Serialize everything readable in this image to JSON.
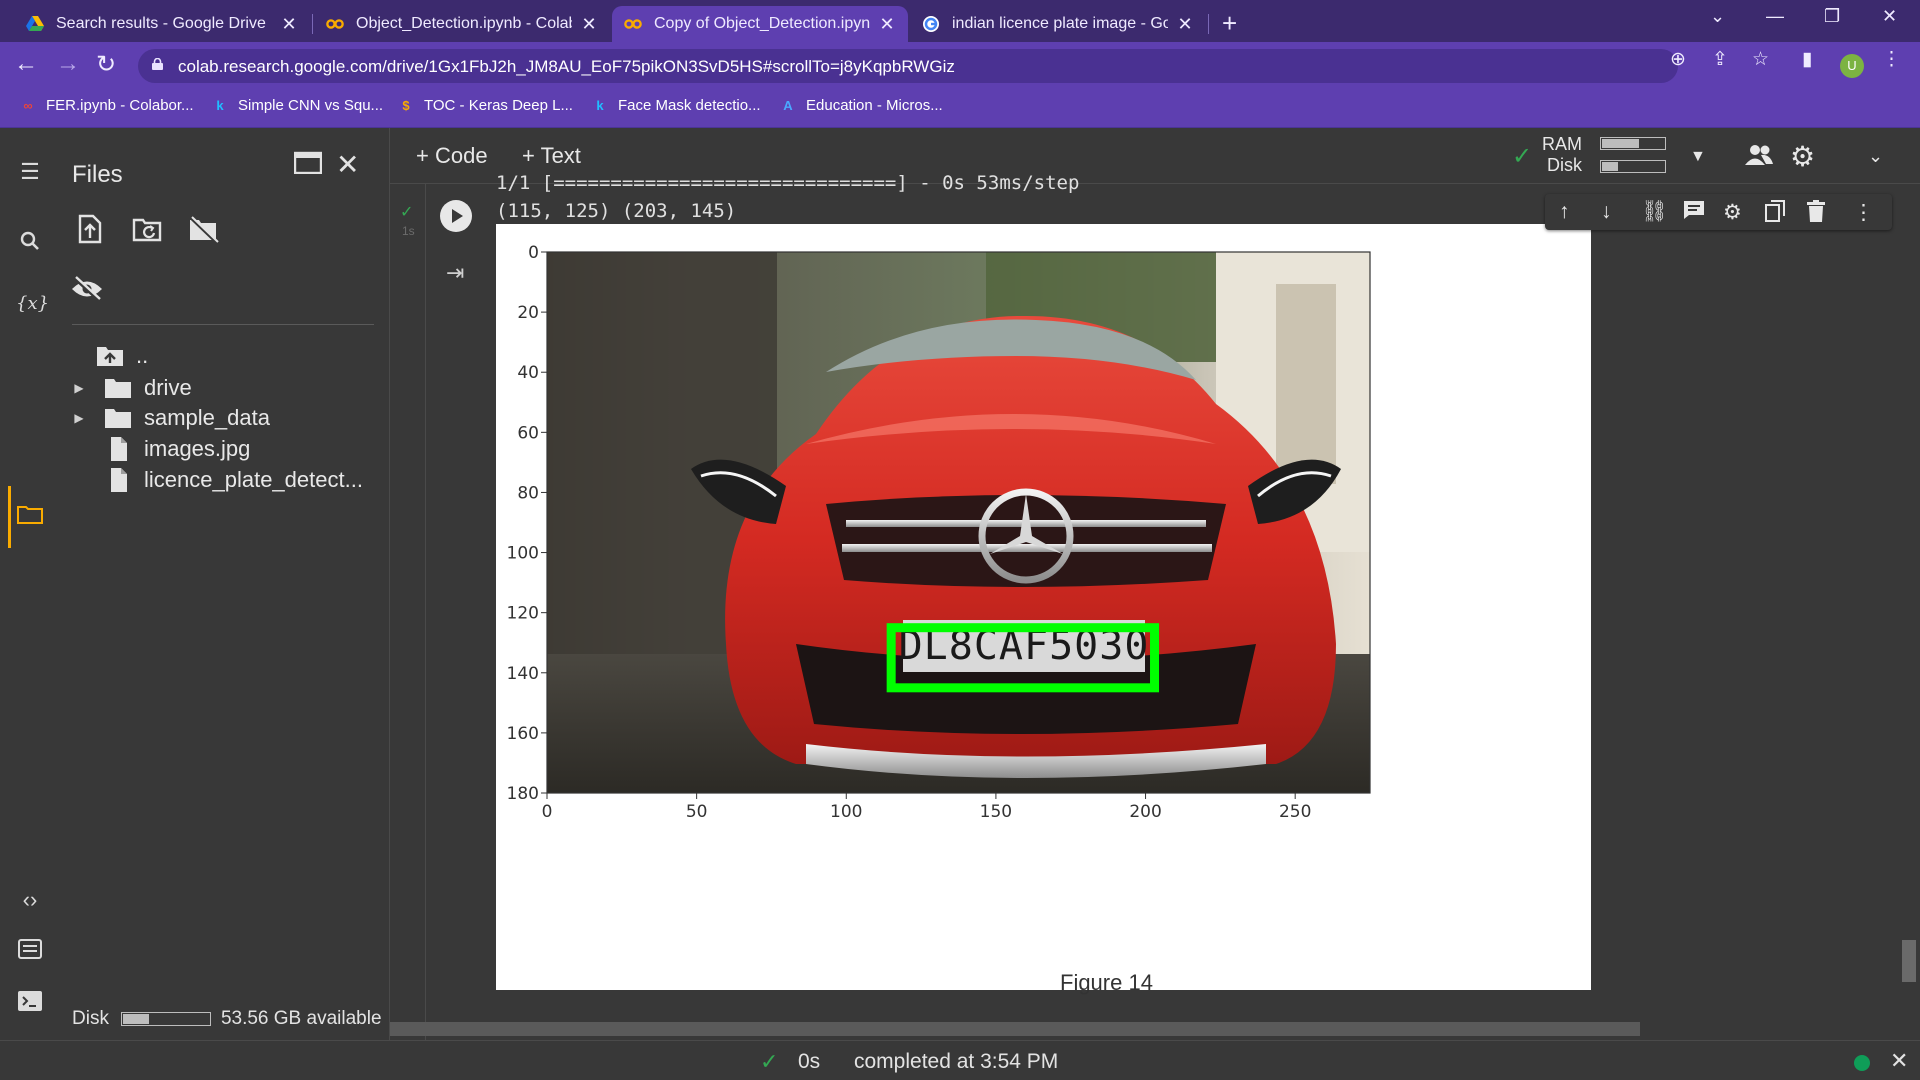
{
  "browser": {
    "tabs": [
      {
        "title": "Search results - Google Drive",
        "icon": "drive-icon"
      },
      {
        "title": "Object_Detection.ipynb - Colabor",
        "icon": "colab-icon"
      },
      {
        "title": "Copy of Object_Detection.ipynb",
        "icon": "colab-icon",
        "active": true
      },
      {
        "title": "indian licence plate image - Goo",
        "icon": "google-icon"
      }
    ],
    "url": "colab.research.google.com/drive/1Gx1FbJ2h_JM8AU_EoF75pikON3SvD5HS#scrollTo=j8yKqpbRWGiz",
    "profile_initial": "U",
    "bookmarks": [
      {
        "label": "FER.ipynb - Colabor...",
        "icon": "colab-icon"
      },
      {
        "label": "Simple CNN vs Squ...",
        "icon": "kaggle-icon"
      },
      {
        "label": "TOC - Keras Deep L...",
        "icon": "tutorials-icon"
      },
      {
        "label": "Face Mask detectio...",
        "icon": "kaggle-icon"
      },
      {
        "label": "Education - Micros...",
        "icon": "azure-icon"
      }
    ]
  },
  "files_panel": {
    "title": "Files",
    "items": [
      {
        "label": "..",
        "type": "up"
      },
      {
        "label": "drive",
        "type": "folder"
      },
      {
        "label": "sample_data",
        "type": "folder"
      },
      {
        "label": "images.jpg",
        "type": "file"
      },
      {
        "label": "licence_plate_detect...",
        "type": "file"
      }
    ],
    "disk_label": "Disk",
    "disk_available": "53.56 GB available",
    "disk_fill": 0.3
  },
  "toolbar": {
    "code_label": "Code",
    "text_label": "Text",
    "ram_label": "RAM",
    "disk_label": "Disk",
    "ram_fill": 0.6,
    "disk_fill": 0.25
  },
  "cell": {
    "exec_time": "1s",
    "progress_line": "1/1 [==============================] - 0s 53ms/step",
    "coords_line": "(115, 125) (203, 145)"
  },
  "figure": {
    "label": "Figure 14",
    "plate_text": "DL8CAF5030",
    "box_color": "#00ff00",
    "car_color": "#d42a22"
  },
  "chart_data": {
    "type": "image",
    "x_ticks": [
      0,
      50,
      100,
      150,
      200,
      250
    ],
    "y_ticks": [
      0,
      20,
      40,
      60,
      80,
      100,
      120,
      140,
      160,
      180
    ],
    "xlim": [
      0,
      275
    ],
    "ylim": [
      180,
      0
    ],
    "detection_box": {
      "x1": 115,
      "y1": 125,
      "x2": 203,
      "y2": 145
    }
  },
  "status": {
    "duration": "0s",
    "completed": "completed at 3:54 PM"
  }
}
